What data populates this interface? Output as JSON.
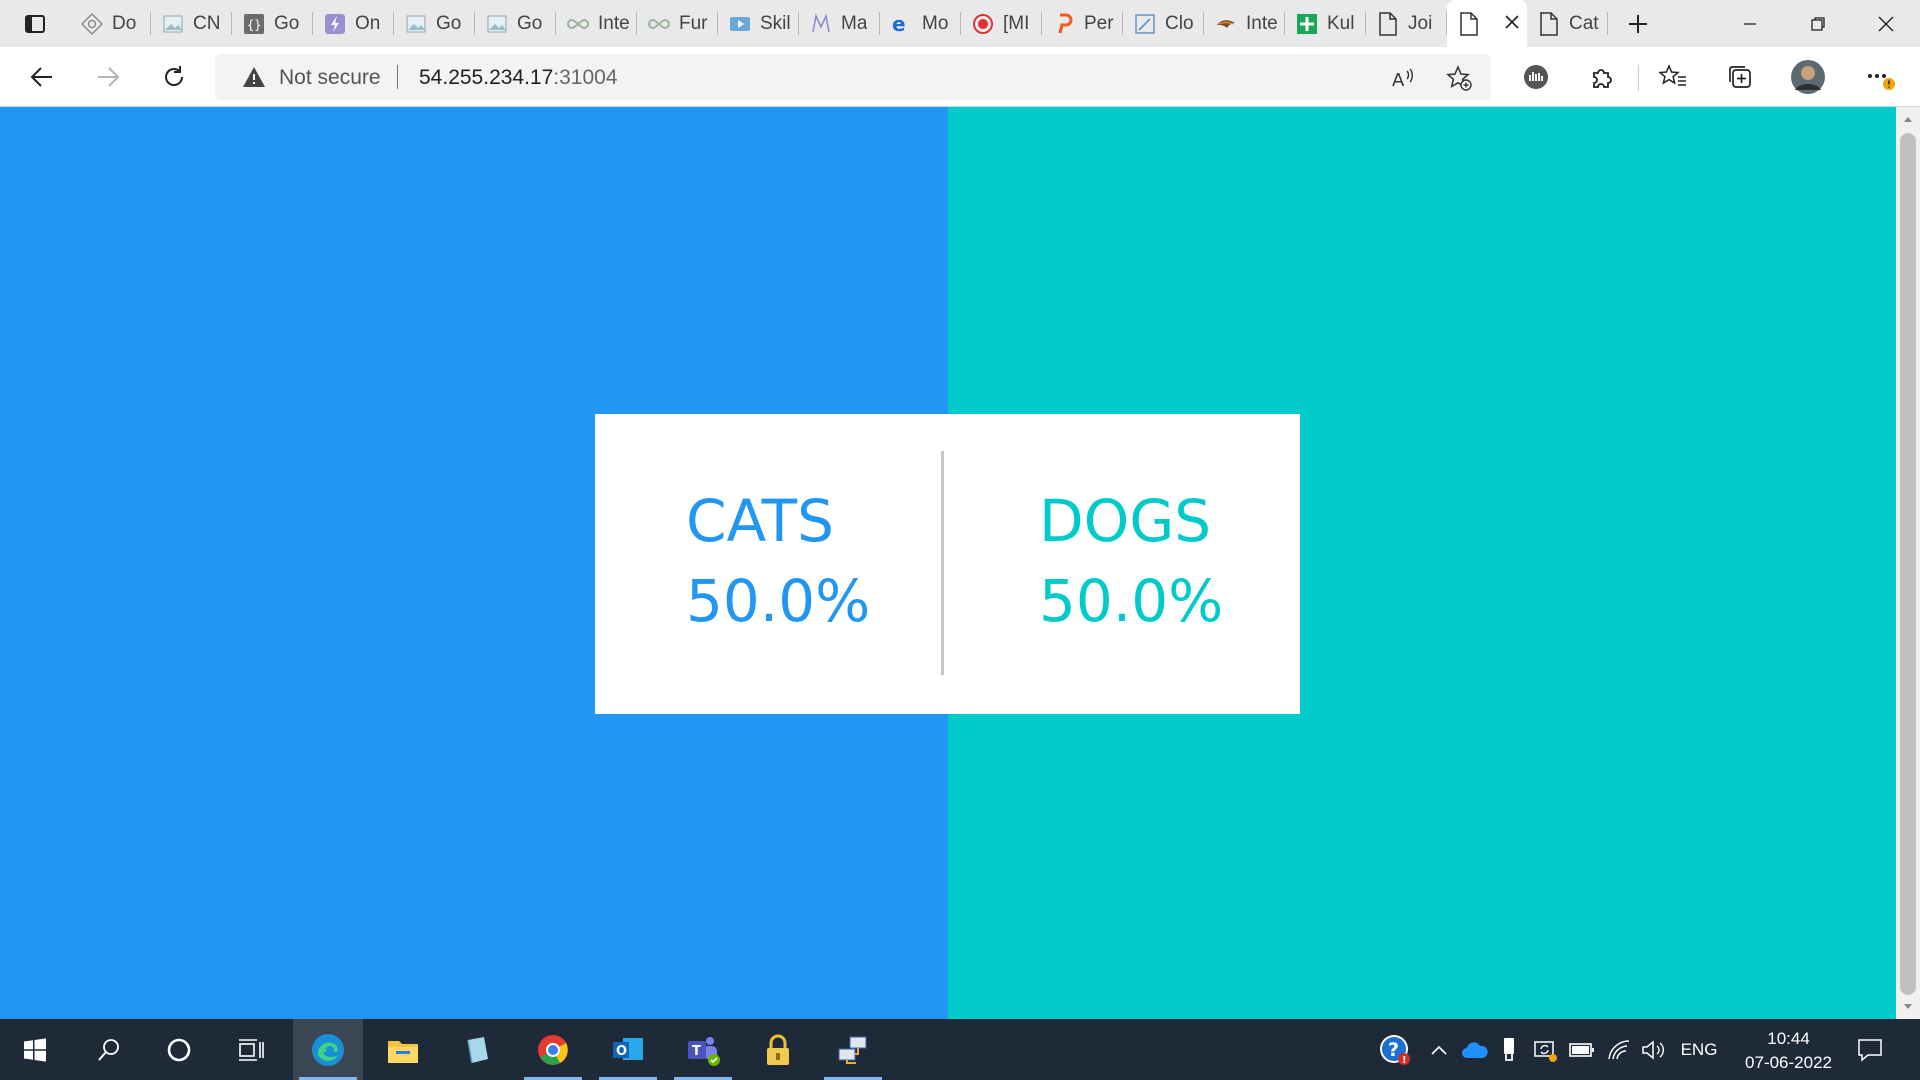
{
  "browser": {
    "tabs": [
      {
        "title": "Do",
        "icon": "settings-diamond-icon"
      },
      {
        "title": "CN",
        "icon": "image-icon"
      },
      {
        "title": "Go",
        "icon": "braces-icon"
      },
      {
        "title": "On",
        "icon": "lightning-icon"
      },
      {
        "title": "Go",
        "icon": "image-icon"
      },
      {
        "title": "Go",
        "icon": "image-icon"
      },
      {
        "title": "Inte",
        "icon": "infinity-icon"
      },
      {
        "title": "Fur",
        "icon": "infinity-icon"
      },
      {
        "title": "Skil",
        "icon": "play-icon"
      },
      {
        "title": "Ma",
        "icon": "m-letter-icon"
      },
      {
        "title": "Mo",
        "icon": "edge-e-icon"
      },
      {
        "title": "[MI",
        "icon": "record-icon"
      },
      {
        "title": "Per",
        "icon": "orange-p-icon"
      },
      {
        "title": "Clo",
        "icon": "pen-square-icon"
      },
      {
        "title": "Inte",
        "icon": "bird-icon"
      },
      {
        "title": "Kul",
        "icon": "green-plus-icon"
      },
      {
        "title": "Joi",
        "icon": "page-icon"
      },
      {
        "title": "",
        "icon": "page-icon",
        "active": true
      },
      {
        "title": "Cat",
        "icon": "page-icon"
      }
    ],
    "address": {
      "warning": "Not secure",
      "host": "54.255.234.17",
      "port": ":31004"
    }
  },
  "page": {
    "left_color": "#2196f3",
    "right_color": "#00cbca",
    "cats": {
      "label": "CATS",
      "percent": "50.0%",
      "color": "#2196f3"
    },
    "dogs": {
      "label": "DOGS",
      "percent": "50.0%",
      "color": "#00cbca"
    }
  },
  "taskbar": {
    "language": "ENG",
    "time": "10:44",
    "date": "07-06-2022"
  }
}
